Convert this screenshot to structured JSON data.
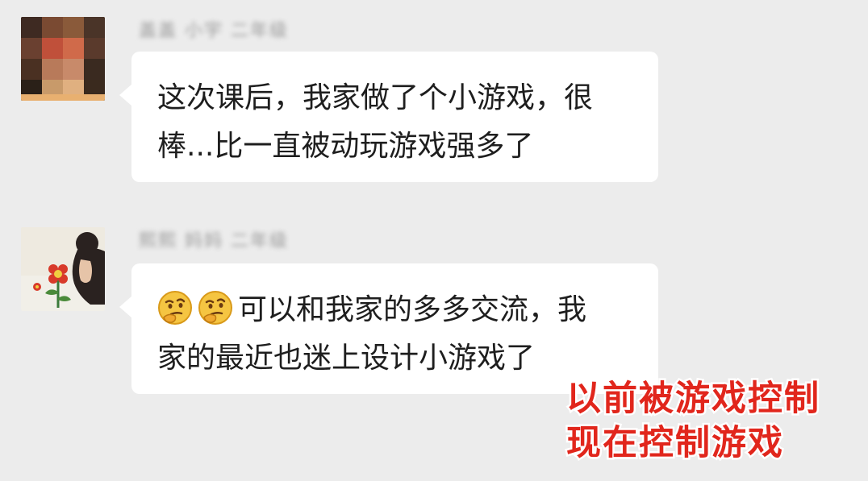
{
  "messages": [
    {
      "sender_name": "盖盖 小宇 二年级",
      "lines": [
        "这次课后，我家做了个小游戏，很",
        "棒...比一直被动玩游戏强多了"
      ]
    },
    {
      "sender_name": "熙熙 妈妈 二年级",
      "emoji": [
        "thinking-face-emoji",
        "thinking-face-emoji"
      ],
      "lines": [
        "可以和我家的多多交流，我",
        "家的最近也迷上设计小游戏了"
      ]
    }
  ],
  "overlay_caption": {
    "line1": "以前被游戏控制",
    "line2": "现在控制游戏"
  },
  "colors": {
    "background": "#ececec",
    "bubble": "#ffffff",
    "caption": "#e1261c"
  }
}
